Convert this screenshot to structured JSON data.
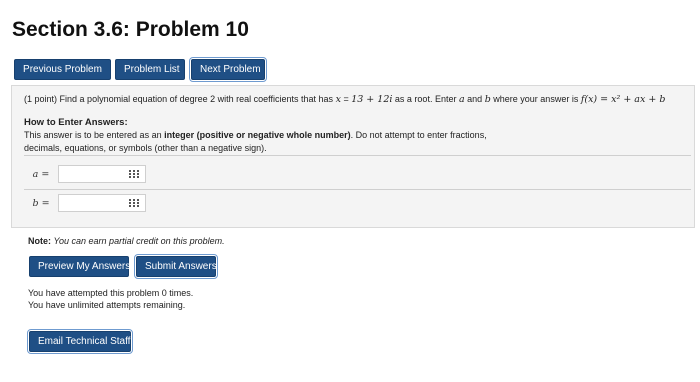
{
  "page": {
    "title": "Section 3.6: Problem 10"
  },
  "nav": {
    "previous": "Previous Problem",
    "list": "Problem List",
    "next": "Next Problem"
  },
  "problem": {
    "points": "(1 point)",
    "q_text1": "Find a polynomial equation of degree 2 with real coefficients that has",
    "q_x": "x",
    "q_eq": " = ",
    "q_root": "13 + 12i",
    "q_text2": " as a root. Enter",
    "q_a": "a",
    "q_and": " and ",
    "q_b": "b",
    "q_text3": " where your answer is",
    "q_func": "f(x) = x² + ax + b",
    "hte_title": "How to Enter Answers:",
    "hte_1": "This answer is to be entered as an",
    "hte_bold": "integer (positive or negative whole number)",
    "hte_2": ". Do not attempt to enter fractions, decimals, equations, or symbols (other than a negative sign)."
  },
  "answers": [
    {
      "label": "a =",
      "value": ""
    },
    {
      "label": "b =",
      "value": ""
    }
  ],
  "note": {
    "label": "Note:",
    "text": "You can earn partial credit on this problem."
  },
  "actions": {
    "preview": "Preview My Answers",
    "submit": "Submit Answers"
  },
  "attempts": {
    "line1": "You have attempted this problem 0 times.",
    "line2": "You have unlimited attempts remaining."
  },
  "footer": {
    "email": "Email Technical Staff"
  },
  "colors": {
    "button_bg": "#1f4f85",
    "panel_bg": "#f4f4f4"
  }
}
